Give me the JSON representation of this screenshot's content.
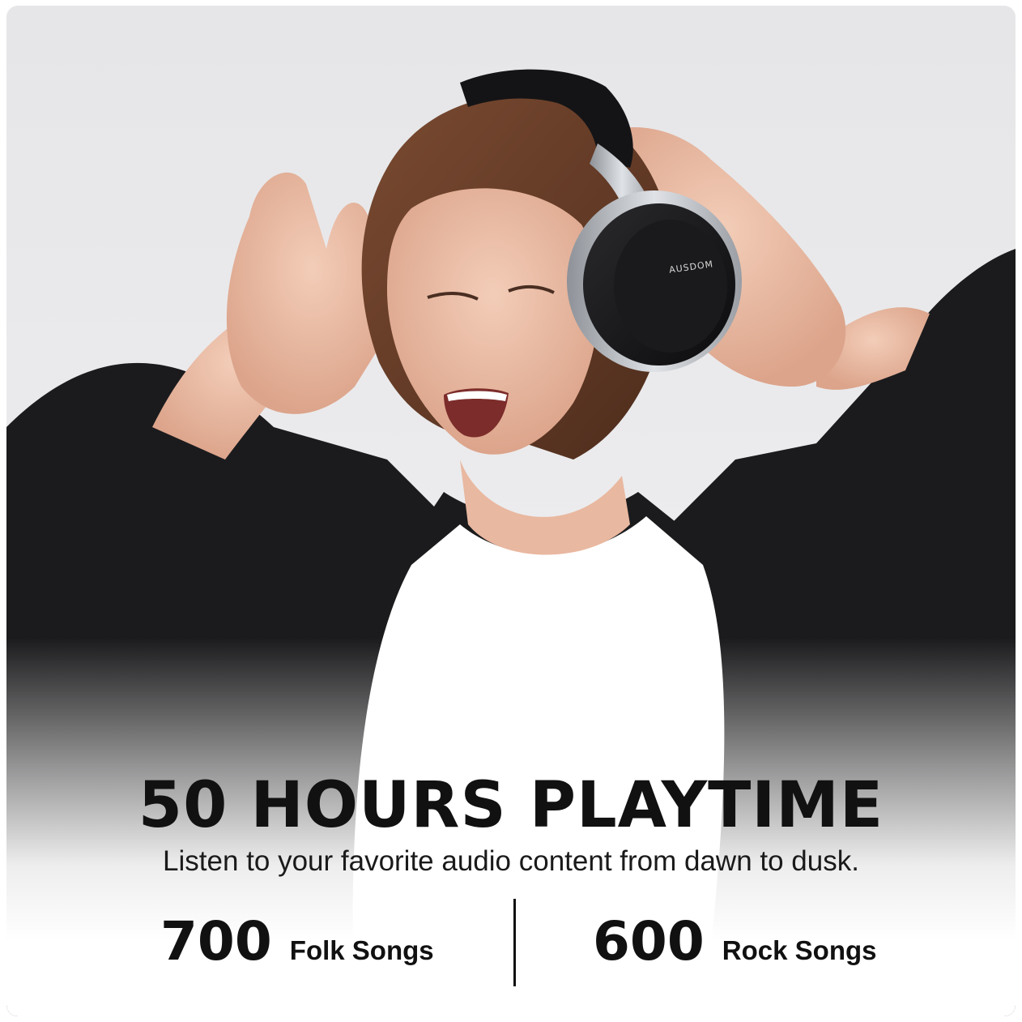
{
  "headline": "50 HOURS PLAYTIME",
  "subheadline": "Listen to your favorite audio content from dawn to dusk.",
  "stats": [
    {
      "number": "700",
      "label": "Folk Songs"
    },
    {
      "number": "600",
      "label": "Rock Songs"
    }
  ],
  "brand_on_headphone": "AUSDOM",
  "colors": {
    "text": "#111111",
    "background": "#ececee",
    "jacket": "#1b1b1d",
    "shirt": "#ffffff",
    "hair": "#6b3f2a",
    "headphone": "#151517",
    "headphone_accent": "#b8bcc2"
  }
}
